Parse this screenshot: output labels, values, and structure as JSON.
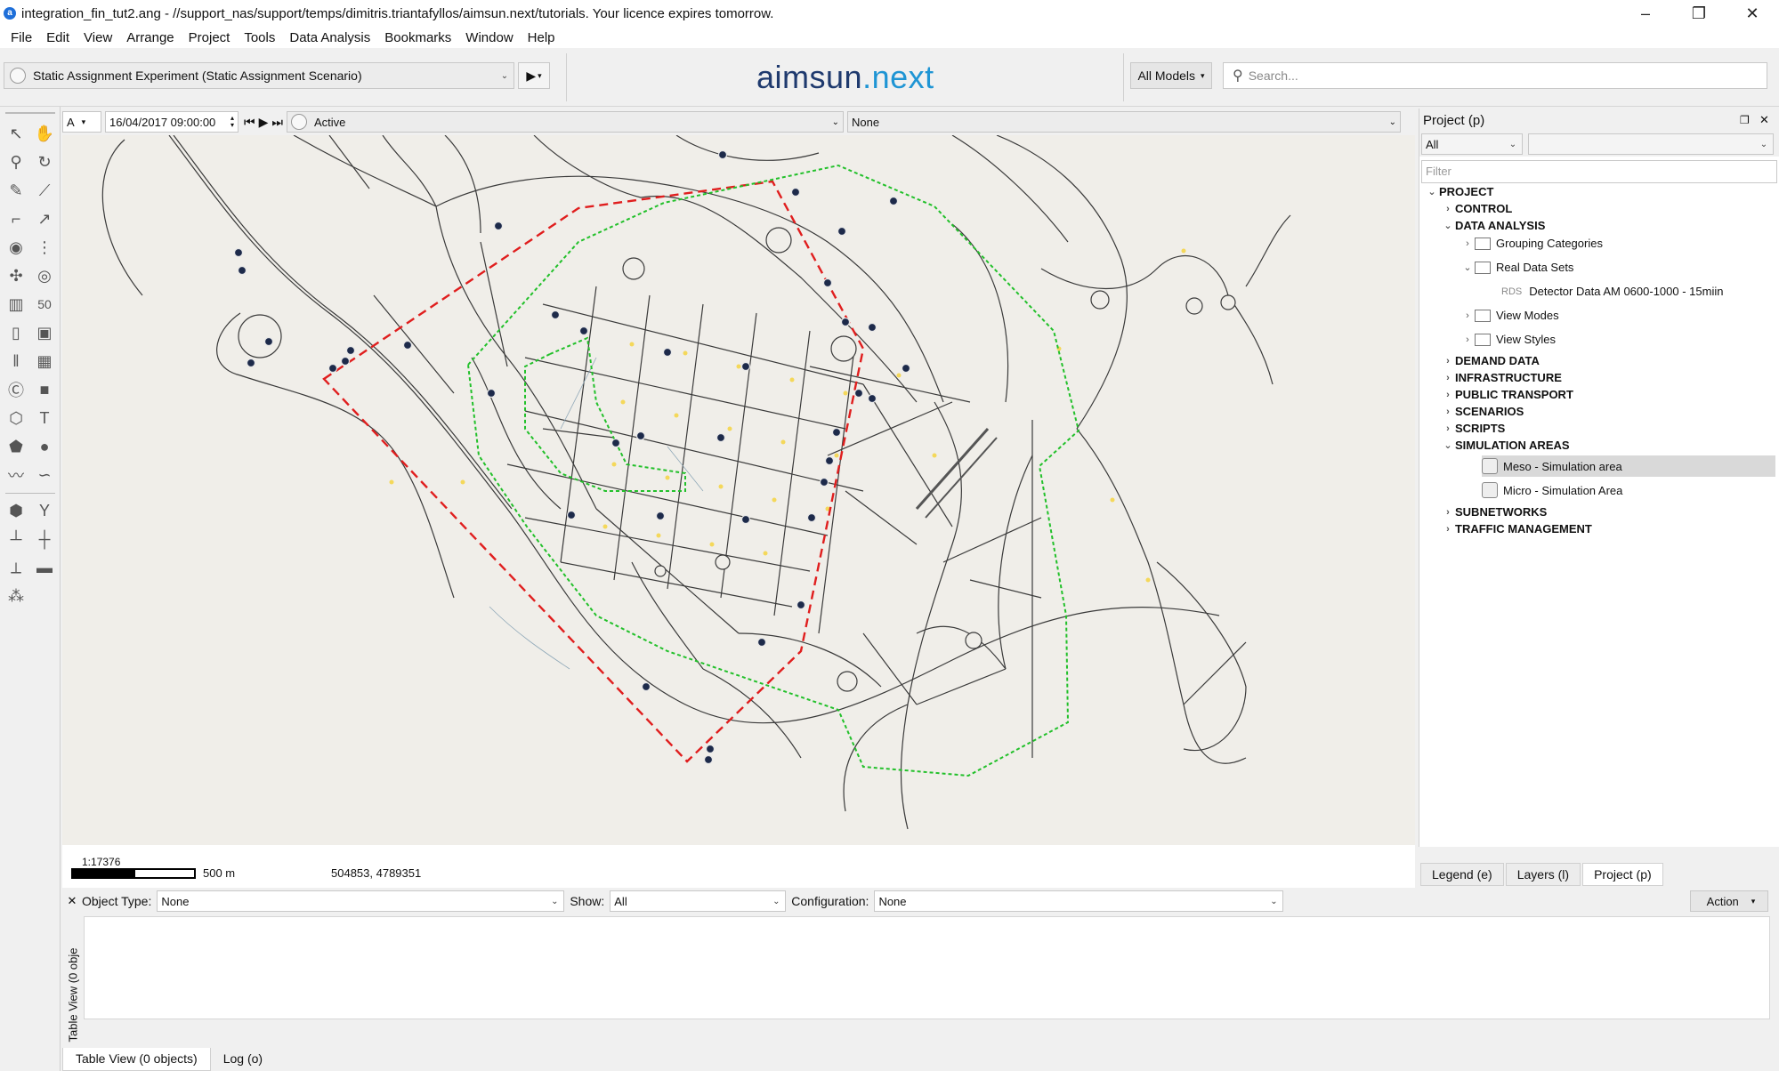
{
  "window": {
    "title": "integration_fin_tut2.ang - //support_nas/support/temps/dimitris.triantafyllos/aimsun.next/tutorials. Your licence expires tomorrow."
  },
  "menu": [
    "File",
    "Edit",
    "View",
    "Arrange",
    "Project",
    "Tools",
    "Data Analysis",
    "Bookmarks",
    "Window",
    "Help"
  ],
  "toolbar": {
    "experiment": "Static Assignment Experiment (Static Assignment Scenario)",
    "logo_a": "aimsun",
    "logo_dot": ".",
    "logo_n": "next",
    "models": "All Models",
    "search_placeholder": "Search..."
  },
  "viewbar": {
    "mode": "A",
    "datetime": "16/04/2017 09:00:00",
    "state": "Active",
    "overlay": "None"
  },
  "map": {
    "scale_label": "1:17376",
    "scale_distance": "500 m",
    "coordinates": "504853, 4789351",
    "colors": {
      "background": "#f0eee9",
      "road": "#3a3a3a",
      "red_boundary": "#e01e1e",
      "green_boundary": "#22c02a",
      "detector": "#1d2a4a",
      "node": "#f4d85a"
    }
  },
  "project_panel": {
    "title": "Project (p)",
    "filter_all": "All",
    "filter_placeholder": "Filter",
    "tree": {
      "root": "PROJECT",
      "control": "CONTROL",
      "data_analysis": "DATA ANALYSIS",
      "grouping": "Grouping Categories",
      "real_data_sets": "Real Data Sets",
      "rds_tag": "RDS",
      "detector_data": "Detector Data AM 0600-1000 - 15miin",
      "view_modes": "View Modes",
      "view_styles": "View Styles",
      "demand": "DEMAND DATA",
      "infrastructure": "INFRASTRUCTURE",
      "public_transport": "PUBLIC TRANSPORT",
      "scenarios": "SCENARIOS",
      "scripts": "SCRIPTS",
      "simulation_areas": "SIMULATION AREAS",
      "meso": "Meso - Simulation area",
      "micro": "Micro - Simulation Area",
      "subnetworks": "SUBNETWORKS",
      "traffic": "TRAFFIC MANAGEMENT"
    },
    "tabs": [
      "Legend (e)",
      "Layers (l)",
      "Project (p)"
    ]
  },
  "bottom_panel": {
    "object_type_label": "Object Type:",
    "object_type_value": "None",
    "show_label": "Show:",
    "show_value": "All",
    "configuration_label": "Configuration:",
    "configuration_value": "None",
    "action": "Action",
    "vertical_title": "Table View (0 obje",
    "tabs": [
      "Table View (0 objects)",
      "Log (o)"
    ]
  }
}
